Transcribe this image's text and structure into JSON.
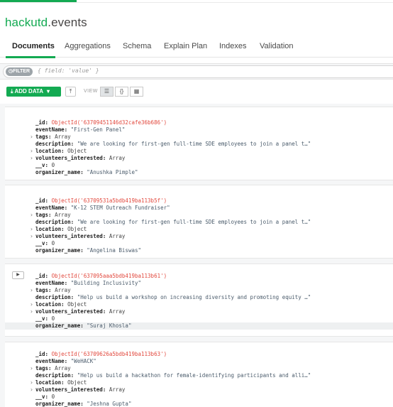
{
  "namespace": {
    "db": "hackutd",
    "dot": ".",
    "collection": "events"
  },
  "tabs": [
    "Documents",
    "Aggregations",
    "Schema",
    "Explain Plan",
    "Indexes",
    "Validation"
  ],
  "filter": {
    "pill": "FILTER",
    "placeholder": "{ field: 'value' }"
  },
  "toolbar": {
    "add_data": "ADD DATA",
    "view_label": "VIEW"
  },
  "icons": {
    "add_data": "download-icon",
    "export": "upload-icon",
    "list_view": "list-icon",
    "json_view": "braces-icon",
    "table_view": "table-icon",
    "expand": "play-triangle-icon",
    "caret": "chevron-right-icon"
  },
  "colors": {
    "accent": "#13aa52",
    "objectid": "#e2483d"
  },
  "documents": [
    {
      "id": "ObjectId('63709451146d32cafe36b686')",
      "eventName": "\"First-Gen Panel\"",
      "tags": "Array",
      "description": "\"We are looking for first-gen full-time SDE employees to join a panel t…\"",
      "location": "Object",
      "volunteers_interested": "Array",
      "v": "0",
      "organizer_name": "\"Anushka Pimple\""
    },
    {
      "id": "ObjectId('63709531a5bdb419ba113b5f')",
      "eventName": "\"K-12 STEM Outreach Fundraiser\"",
      "tags": "Array",
      "description": "\"We are looking for first-gen full-time SDE employees to join a panel t…\"",
      "location": "Object",
      "volunteers_interested": "Array",
      "v": "0",
      "organizer_name": "\"Angelina Biswas\""
    },
    {
      "id": "ObjectId('637095aaa5bdb419ba113b61')",
      "eventName": "\"Building Inclusivity\"",
      "tags": "Array",
      "description": "\"Help us build a workshop on increasing diversity and promoting equity …\"",
      "location": "Object",
      "volunteers_interested": "Array",
      "v": "0",
      "organizer_name": "\"Suraj Khosla\""
    },
    {
      "id": "ObjectId('63709626a5bdb419ba113b63')",
      "eventName": "\"WeHACK\"",
      "tags": "Array",
      "description": "\"Help us build a hackathon for female-identifying participants and alli…\"",
      "location": "Object",
      "volunteers_interested": "Array",
      "v": "0",
      "organizer_name": "\"Jeshna Gupta\""
    }
  ],
  "field_keys": {
    "id": "_id:",
    "eventName": "eventName:",
    "tags": "tags:",
    "description": "description:",
    "location": "location:",
    "volunteers_interested": "volunteers_interested:",
    "v": "__v:",
    "organizer_name": "organizer_name:"
  }
}
